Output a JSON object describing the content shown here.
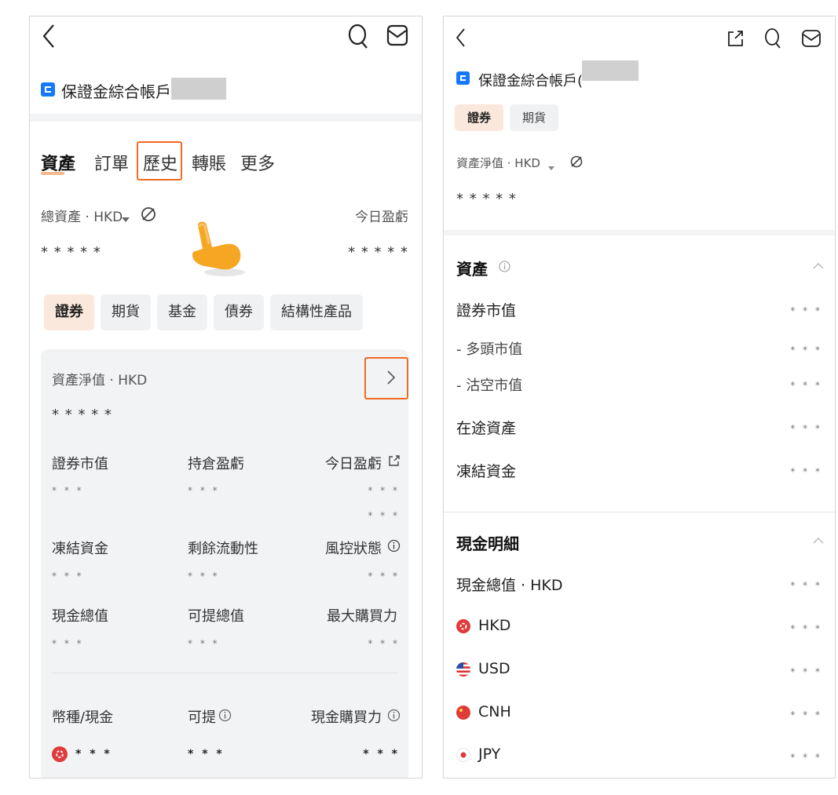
{
  "left_panel": {
    "account_name": "保證金綜合帳戶(",
    "tabs": [
      "資產",
      "訂單",
      "歷史",
      "轉賬",
      "更多"
    ],
    "total_assets_label": "總資產 · HKD",
    "today_pl_label": "今日盈虧",
    "total_assets_value": "* * * * *",
    "today_pl_value": "* * * * *",
    "category_chips": [
      "證券",
      "期貨",
      "基金",
      "債券",
      "結構性產品"
    ],
    "net_asset_label": "資產淨值 · HKD",
    "net_asset_value": "* * * * *",
    "metrics": [
      {
        "label": "證券市值",
        "value": "* * *"
      },
      {
        "label": "持倉盈虧",
        "value": "* * *"
      },
      {
        "label": "今日盈虧",
        "value": "* * *"
      },
      {
        "label": "凍結資金",
        "value": "* * *"
      },
      {
        "label": "剩餘流動性",
        "value": "* * *"
      },
      {
        "label": "風控狀態",
        "value": "* * *"
      },
      {
        "label": "現金總值",
        "value": "* * *"
      },
      {
        "label": "可提總值",
        "value": "* * *"
      },
      {
        "label": "最大購買力",
        "value": "* * *"
      }
    ],
    "extra_value": "* * *",
    "currency_header": [
      "幣種/現金",
      "可提",
      "現金購買力"
    ],
    "currency_row_values": [
      "* * *",
      "* * *",
      "* * *"
    ]
  },
  "right_panel": {
    "account_name": "保證金綜合帳戶(",
    "chips": [
      "證券",
      "期貨"
    ],
    "net_asset_label": "資產淨值 · HKD",
    "net_asset_value": "* * * * *",
    "assets_section": {
      "title": "資產",
      "rows": [
        {
          "label": "證券市值",
          "value": "* * *"
        },
        {
          "label": "- 多頭市值",
          "value": "* * *"
        },
        {
          "label": "- 沽空市值",
          "value": "* * *"
        },
        {
          "label": "在途資產",
          "value": "* * *"
        },
        {
          "label": "凍結資金",
          "value": "* * *"
        }
      ]
    },
    "cash_section": {
      "title": "現金明細",
      "rows": [
        {
          "label": "現金總值 · HKD",
          "value": "* * *"
        },
        {
          "label": "HKD",
          "value": "* * *"
        },
        {
          "label": "USD",
          "value": "* * *"
        },
        {
          "label": "CNH",
          "value": "* * *"
        },
        {
          "label": "JPY",
          "value": "* * *"
        }
      ]
    }
  },
  "colors": {
    "accent": "#f06a22",
    "brand_blue": "#1677ff",
    "chip_active_bg": "#fbe8dc",
    "card_bg": "#f2f3f5"
  }
}
